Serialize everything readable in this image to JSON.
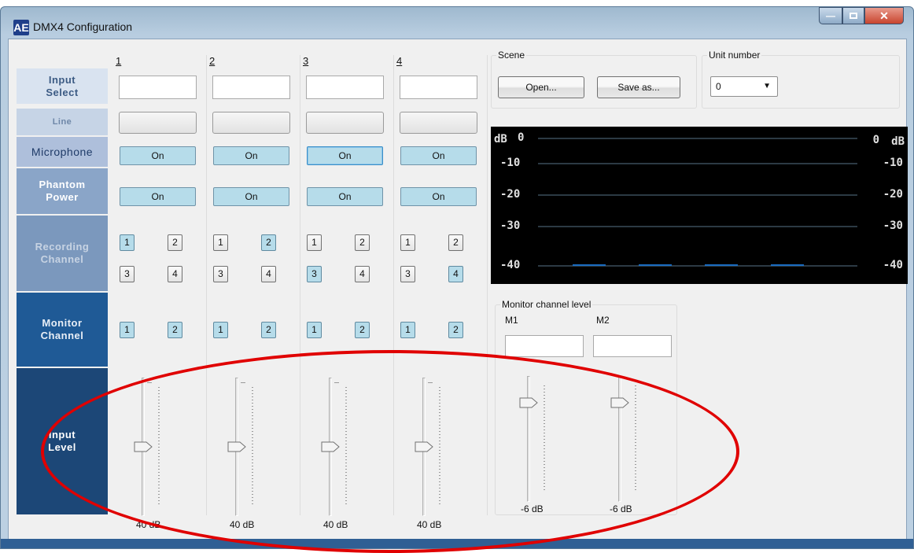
{
  "window": {
    "title": "DMX4 Configuration",
    "logo": "AE"
  },
  "row_labels": {
    "input_select": "Input\nSelect",
    "line": "Line",
    "microphone": "Microphone",
    "phantom_power": "Phantom\nPower",
    "recording_channel": "Recording\nChannel",
    "monitor_channel": "Monitor\nChannel",
    "input_level": "Input\nLevel"
  },
  "channels": [
    {
      "number": "1",
      "input_select": "",
      "line_label": "",
      "mic": "On",
      "phantom": "On",
      "rec": [
        "1",
        "2",
        "3",
        "4"
      ],
      "mon": [
        "1",
        "2"
      ],
      "level": "40 dB",
      "level_value": 0.5
    },
    {
      "number": "2",
      "input_select": "",
      "line_label": "",
      "mic": "On",
      "phantom": "On",
      "rec": [
        "1",
        "2",
        "3",
        "4"
      ],
      "mon": [
        "1",
        "2"
      ],
      "level": "40 dB",
      "level_value": 0.5
    },
    {
      "number": "3",
      "input_select": "",
      "line_label": "",
      "mic": "On",
      "phantom": "On",
      "rec": [
        "1",
        "2",
        "3",
        "4"
      ],
      "mon": [
        "1",
        "2"
      ],
      "level": "40 dB",
      "level_value": 0.5
    },
    {
      "number": "4",
      "input_select": "",
      "line_label": "",
      "mic": "On",
      "phantom": "On",
      "rec": [
        "1",
        "2",
        "3",
        "4"
      ],
      "mon": [
        "1",
        "2"
      ],
      "level": "40 dB",
      "level_value": 0.5
    }
  ],
  "rec_selected": [
    [
      true,
      false,
      false,
      false
    ],
    [
      false,
      true,
      false,
      false
    ],
    [
      false,
      false,
      true,
      false
    ],
    [
      false,
      false,
      false,
      true
    ]
  ],
  "mon_selected": [
    [
      true,
      true
    ],
    [
      true,
      true
    ],
    [
      true,
      true
    ],
    [
      true,
      true
    ]
  ],
  "scene": {
    "title": "Scene",
    "open": "Open...",
    "save_as": "Save as..."
  },
  "unit": {
    "title": "Unit number",
    "value": "0"
  },
  "meter": {
    "unit_left": "dB",
    "unit_right": "dB",
    "scale": [
      "0",
      "-10",
      "-20",
      "-30",
      "-40"
    ],
    "channel_levels_db": [
      -40,
      -40,
      -40,
      -40
    ]
  },
  "monitor_level": {
    "title": "Monitor channel level",
    "m1": {
      "label": "M1",
      "value": "",
      "level": "-6 dB",
      "level_value": 0.83
    },
    "m2": {
      "label": "M2",
      "value": "",
      "level": "-6 dB",
      "level_value": 0.83
    }
  },
  "colors": {
    "selected": "#b6dcea",
    "annotation": "#e00000",
    "label_dark": "#1c4777",
    "label_light": "#9db3d0"
  }
}
